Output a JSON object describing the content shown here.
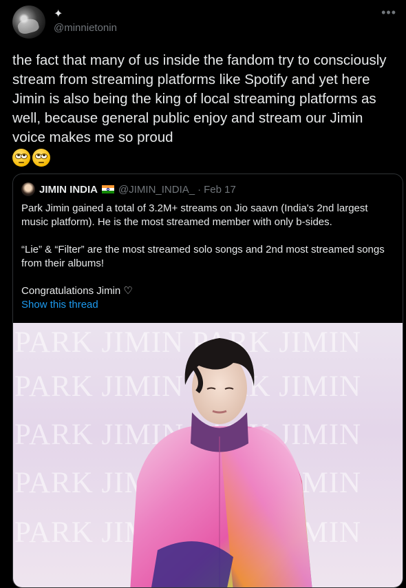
{
  "tweet": {
    "badge": "✦",
    "handle": "@minnietonin",
    "more": "•••",
    "text": "the fact that many of us inside the fandom try to consciously stream from streaming platforms like Spotify and yet here Jimin is also being the king of local streaming platforms as well, because general public enjoy and stream our Jimin voice makes me so proud",
    "emojis": [
      "face-with-rolling-eyes",
      "face-with-rolling-eyes"
    ]
  },
  "quote": {
    "name": "JIMIN INDIA",
    "flag": "india-flag",
    "handle": "@JIMIN_INDIA_",
    "dot": "·",
    "date": "Feb 17",
    "p1": "Park Jimin gained a total of 3.2M+ streams on Jio saavn (India's 2nd largest music platform). He is the most streamed member with only b-sides.",
    "p2": "“Lie” & “Filter” are the most streamed solo songs and 2nd most streamed songs from their albums!",
    "p3": "Congratulations Jimin ♡",
    "show_thread": "Show this thread",
    "image": {
      "watermark_rows": [
        "PARK JIMIN PARK JIMIN",
        "PARK JIMIN PARK JIMIN",
        "PARK JIMIN PARK JIMIN",
        "PARK JIMIN PARK JIMIN",
        "PARK JIMIN PARK JIMIN"
      ]
    }
  },
  "colors": {
    "background": "#000000",
    "text": "#e7e9ea",
    "muted": "#71767b",
    "link": "#1d9bf0",
    "border": "#2f3336"
  }
}
